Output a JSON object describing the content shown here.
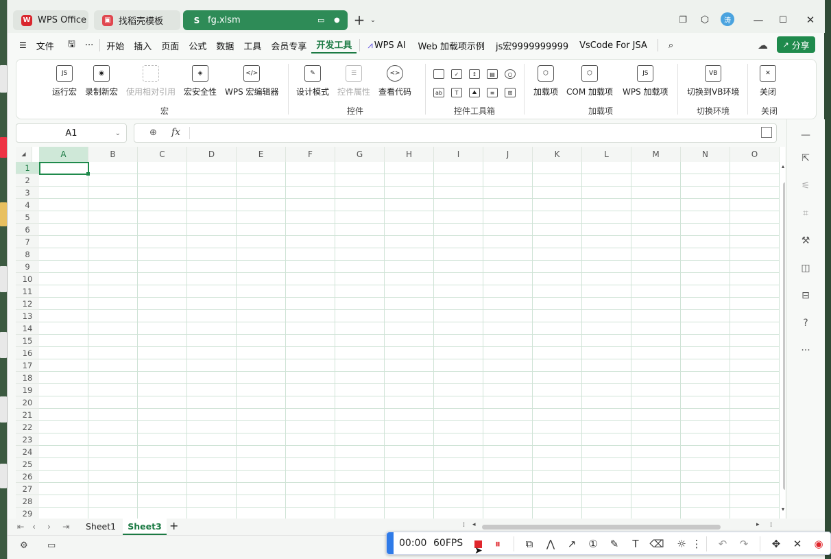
{
  "tabs": [
    {
      "label": "WPS Office",
      "icon": "wps-logo-icon"
    },
    {
      "label": "找稻壳模板",
      "icon": "docer-icon"
    },
    {
      "label": "fg.xlsm",
      "icon": "spreadsheet-icon"
    }
  ],
  "user_avatar": "涛",
  "menu": {
    "file": "文件",
    "items": [
      "开始",
      "插入",
      "页面",
      "公式",
      "数据",
      "工具",
      "会员专享",
      "开发工具",
      "WPS AI",
      "Web 加载项示例",
      "js宏9999999999",
      "VsCode For JSA"
    ],
    "active": "开发工具",
    "share": "分享"
  },
  "ribbon": {
    "macro": {
      "run": "运行宏",
      "record": "录制新宏",
      "relative": "使用相对引用",
      "security": "宏安全性",
      "editor": "WPS 宏编辑器",
      "group": "宏"
    },
    "controls": {
      "design": "设计模式",
      "props": "控件属性",
      "code": "查看代码",
      "group": "控件"
    },
    "toolbox": {
      "group": "控件工具箱"
    },
    "addins": {
      "addin": "加载项",
      "com": "COM 加载项",
      "wps": "WPS 加载项",
      "group": "加载项"
    },
    "env": {
      "switch": "切换到VB环境",
      "group": "切换环境"
    },
    "close": {
      "close": "关闭",
      "group": "关闭"
    }
  },
  "formula_bar": {
    "cell_ref": "A1",
    "fx": "fx"
  },
  "columns": [
    "A",
    "B",
    "C",
    "D",
    "E",
    "F",
    "G",
    "H",
    "I",
    "J",
    "K",
    "L",
    "M",
    "N",
    "O"
  ],
  "rows": [
    "1",
    "2",
    "3",
    "4",
    "5",
    "6",
    "7",
    "8",
    "9",
    "10",
    "11",
    "12",
    "13",
    "14",
    "15",
    "16",
    "17",
    "18",
    "19",
    "20",
    "21",
    "22",
    "23",
    "24",
    "25",
    "26",
    "27",
    "28",
    "29"
  ],
  "sheets": {
    "items": [
      "Sheet1",
      "Sheet3"
    ],
    "active": "Sheet3"
  },
  "recorder": {
    "time": "00:00",
    "fps": "60FPS"
  },
  "colors": {
    "accent": "#1b7a43",
    "tab_active": "#2e8b57",
    "record_blue": "#2f7be8",
    "record_red": "#e0262c"
  }
}
